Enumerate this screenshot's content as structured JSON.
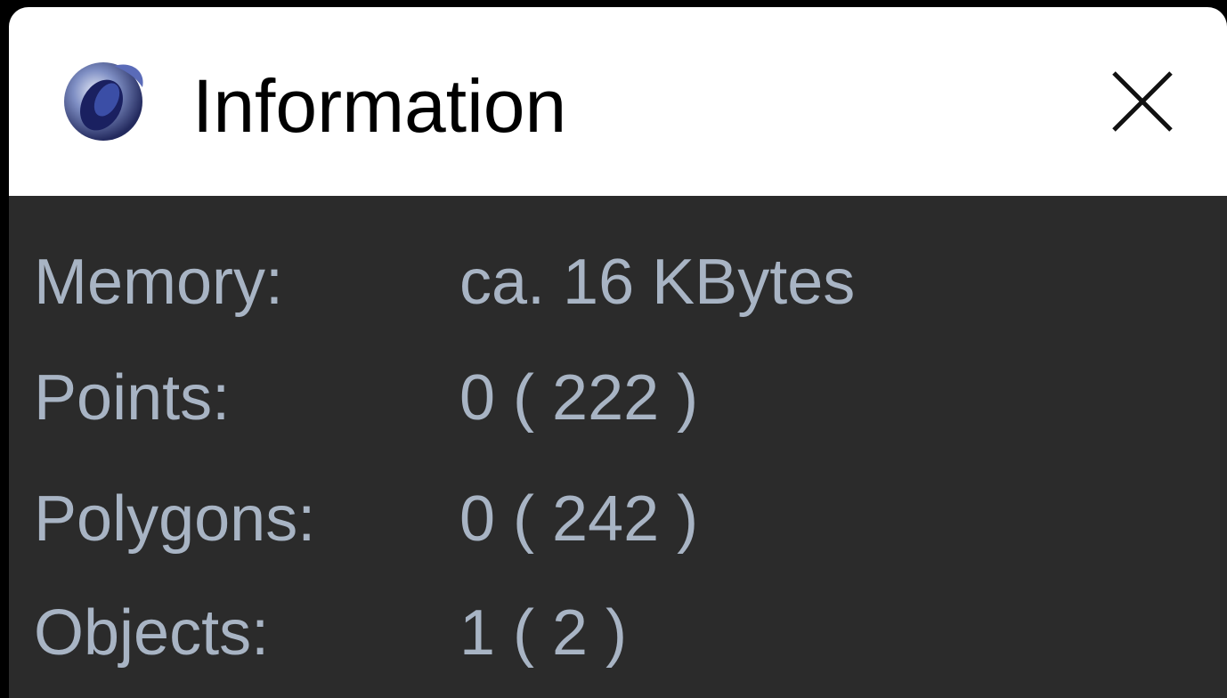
{
  "window": {
    "title": "Information",
    "icon": "cinema4d-app-icon",
    "close_icon": "close-icon"
  },
  "info": {
    "rows": [
      {
        "label": "Memory:",
        "value": "ca. 16 KBytes"
      },
      {
        "label": "Points:",
        "value": "0 ( 222 )"
      },
      {
        "label": "Polygons:",
        "value": "0 ( 242 )"
      },
      {
        "label": "Objects:",
        "value": "1 ( 2 )"
      }
    ]
  },
  "colors": {
    "titlebar_bg": "#ffffff",
    "content_bg": "#2b2b2b",
    "text": "#a8b4c4"
  }
}
